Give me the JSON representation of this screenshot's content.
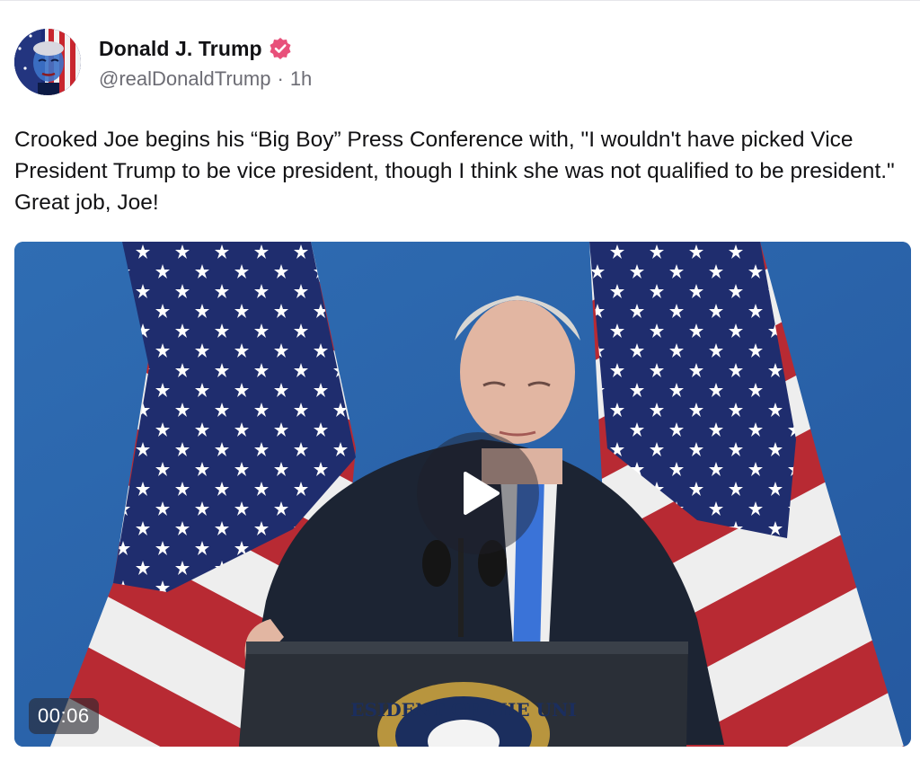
{
  "author": {
    "display_name": "Donald J. Trump",
    "handle": "@realDonaldTrump",
    "separator": "·",
    "time_ago": "1h",
    "verified": true,
    "verified_color": "#e8507a"
  },
  "post": {
    "text": "Crooked Joe begins his “Big Boy” Press Conference with, \"I wouldn't have picked Vice President Trump to be vice president, though I think she was not qualified to be president.\" Great job, Joe!"
  },
  "media": {
    "type": "video",
    "duration": "00:06",
    "play_icon": "play-icon",
    "seal_text": "ESIDENT OF THE UNI",
    "background_color": "#2a63a8"
  }
}
